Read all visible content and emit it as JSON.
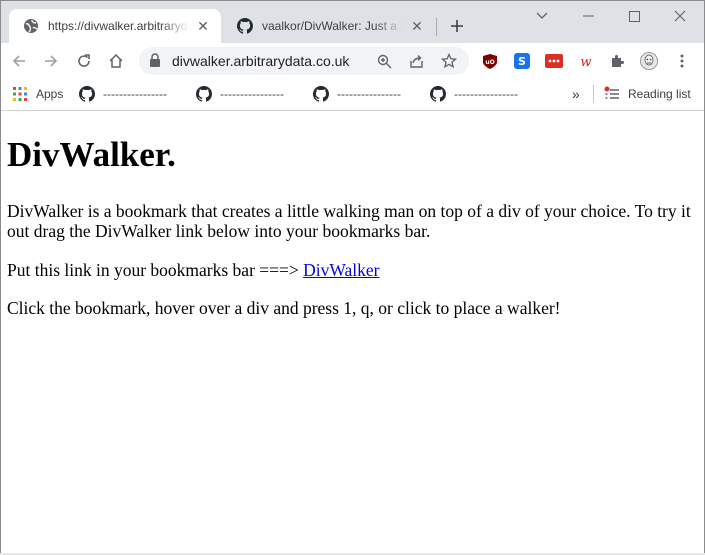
{
  "tabs": [
    {
      "title": "https://divwalker.arbitrarydata.co.uk",
      "active": true,
      "favicon": "globe-icon"
    },
    {
      "title": "vaalkor/DivWalker: Just a little walking man",
      "active": false,
      "favicon": "github-icon"
    }
  ],
  "toolbar": {
    "url": "divwalker.arbitrarydata.co.uk"
  },
  "bookmarks": {
    "apps_label": "Apps",
    "items": [
      {
        "label": "----------------",
        "icon": "github-icon"
      },
      {
        "label": "----------------",
        "icon": "github-icon"
      },
      {
        "label": "----------------",
        "icon": "github-icon"
      },
      {
        "label": "----------------",
        "icon": "github-icon"
      }
    ],
    "overflow_label": "»",
    "reading_list_label": "Reading list"
  },
  "page": {
    "heading": "DivWalker.",
    "intro": "DivWalker is a bookmark that creates a little walking man on top of a div of your choice. To try it out drag the DivWalker link below into your bookmarks bar.",
    "link_prefix": "Put this link in your bookmarks bar ===> ",
    "link_label": "DivWalker",
    "instructions": "Click the bookmark, hover over a div and press 1, q, or click to place a walker!"
  },
  "colors": {
    "tabstrip": "#dee1e6",
    "link": "#0000ee",
    "omnibox": "#f1f3f4"
  }
}
